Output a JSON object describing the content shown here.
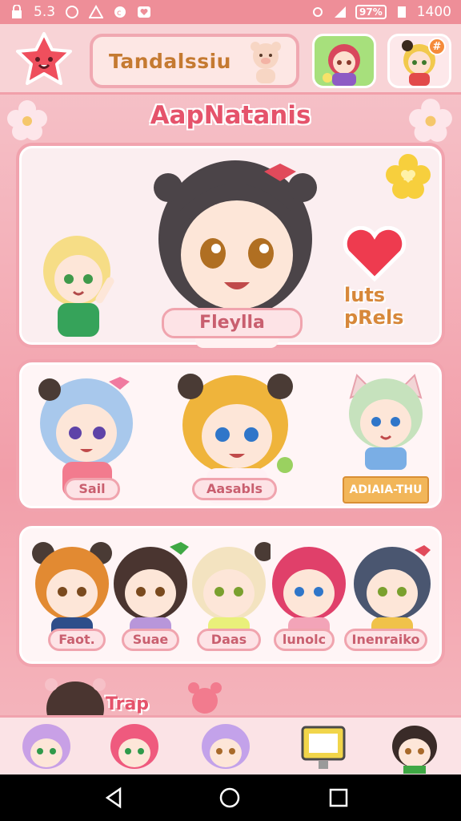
{
  "status_bar": {
    "left_text": "5.3",
    "right_text": "1400",
    "battery_text": "97%"
  },
  "header": {
    "title": "Tandalssiu",
    "profile_badge": "#"
  },
  "section": {
    "title": "AapNatanis"
  },
  "featured": {
    "main_name": "Fleylla",
    "side_label": "luts pRels"
  },
  "row2": {
    "names": [
      "Sail",
      "Aasabls"
    ],
    "ribbon": "ADIAIA-THU"
  },
  "row3": {
    "names": [
      "Faot.",
      "Suae",
      "Daas",
      "lunolc",
      "Inenraiko"
    ]
  },
  "more": {
    "label": "Trap"
  },
  "colors": {
    "accent": "#e5536b",
    "panel_border": "#f1a3ae",
    "background": "#f3a6ae"
  },
  "icons": {
    "logo": "star-face-icon",
    "settings": "gear-icon",
    "back": "back-triangle-icon",
    "home": "home-circle-icon",
    "recents": "recents-square-icon"
  }
}
